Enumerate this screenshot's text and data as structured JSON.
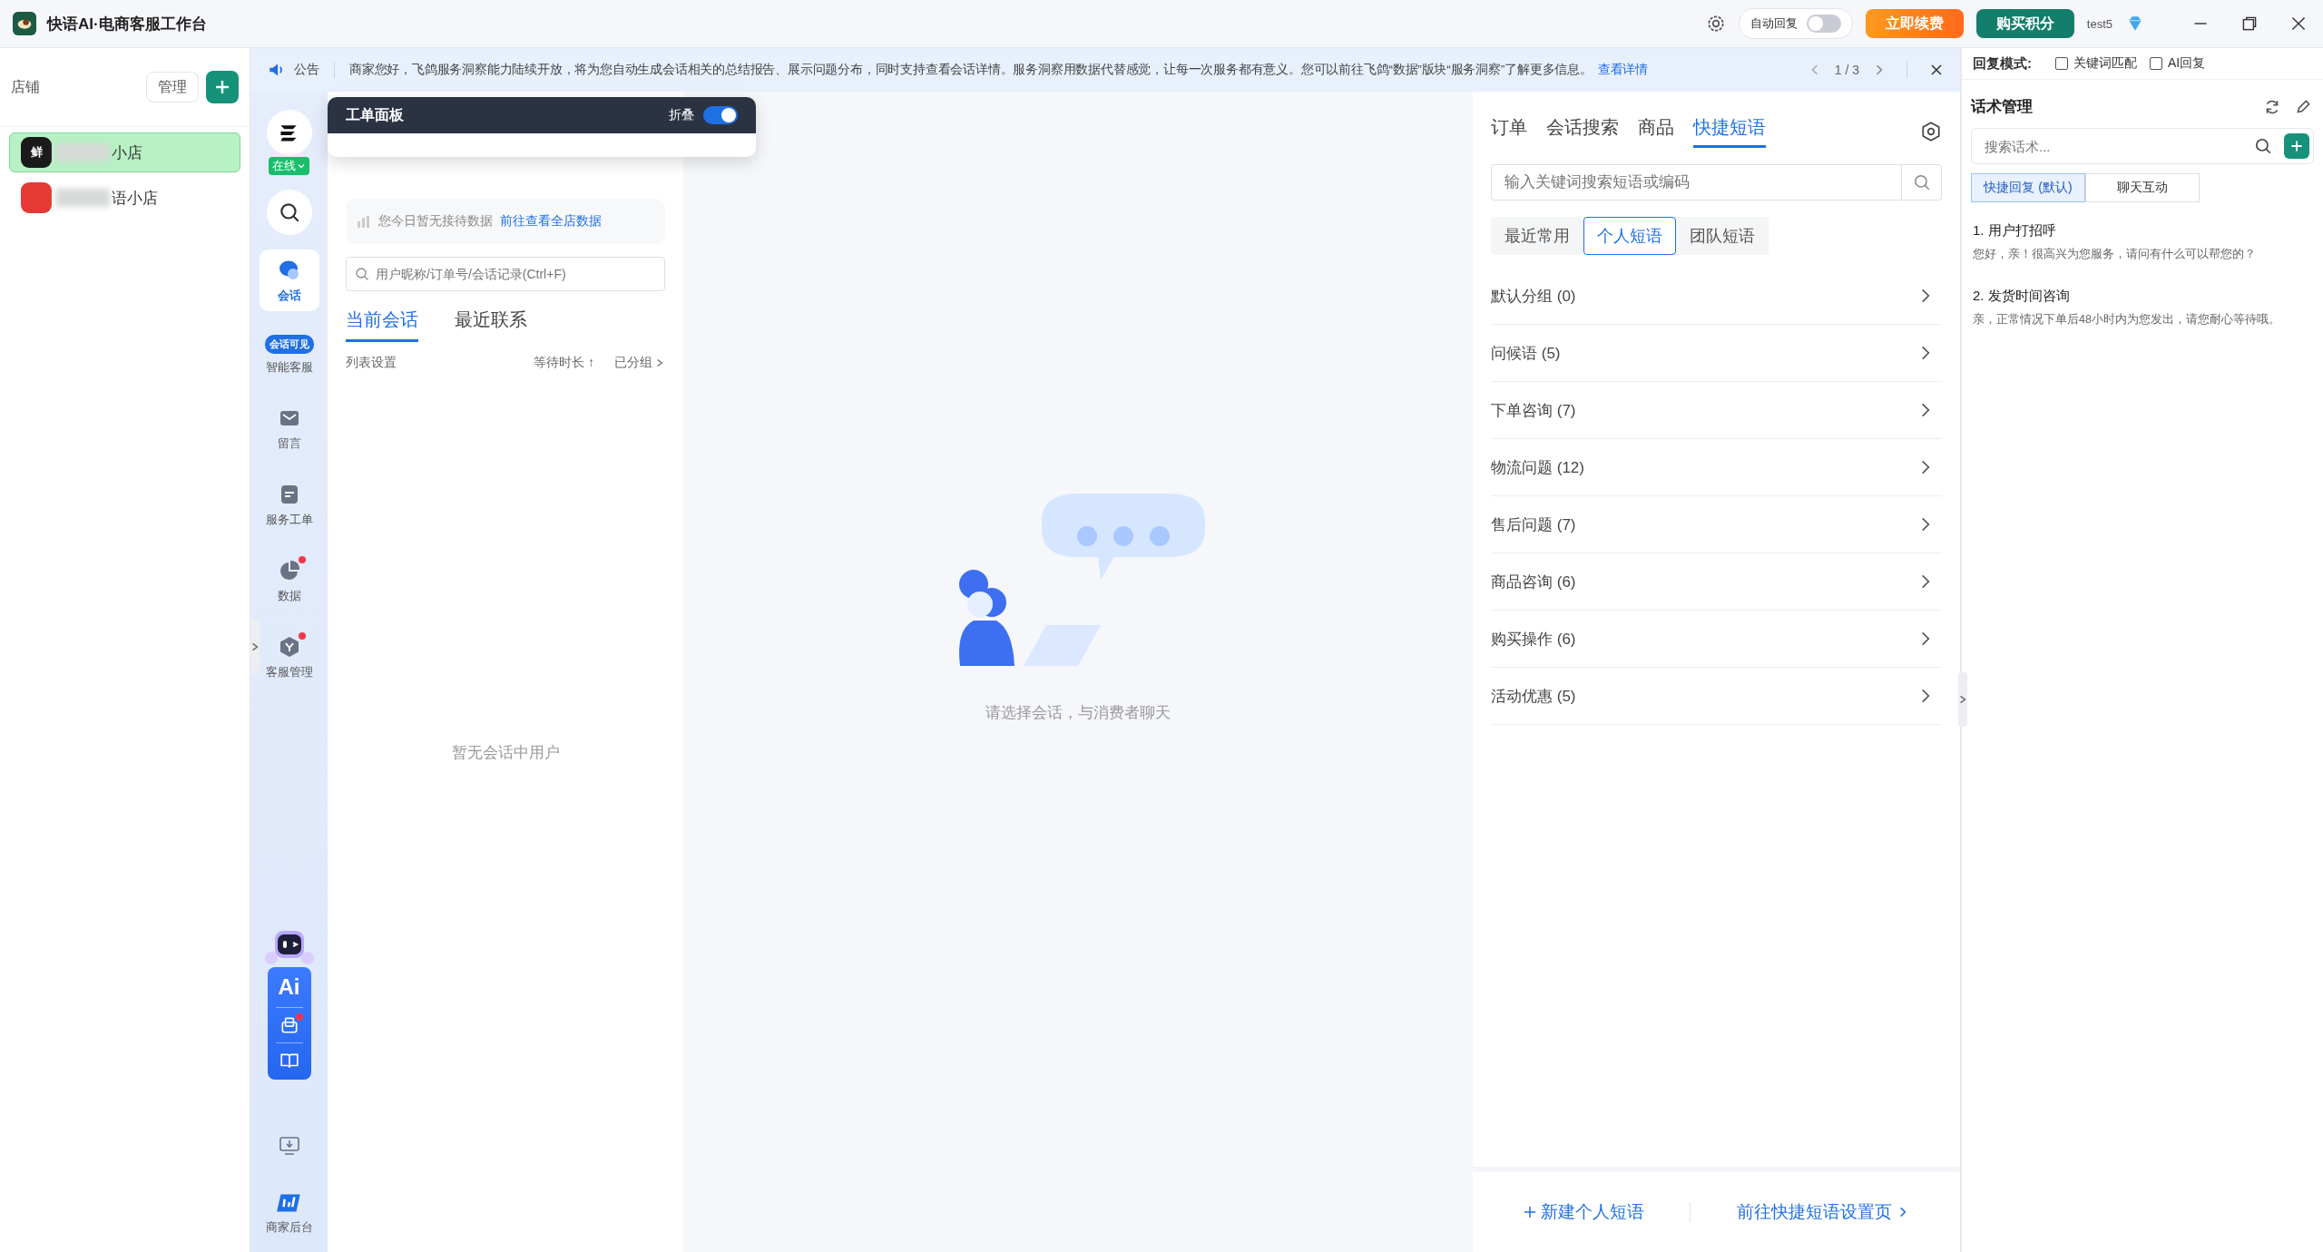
{
  "window": {
    "title": "快语AI·电商客服工作台",
    "auto_reply": {
      "label": "自动回复",
      "on": false
    },
    "buttons": [
      {
        "label": "立即续费",
        "kind": "renew"
      },
      {
        "label": "购买积分",
        "kind": "buy"
      }
    ],
    "user": "test5"
  },
  "shops": {
    "title": "店铺",
    "manage": "管理",
    "items": [
      {
        "avatar": "鲜",
        "name": "小店",
        "selected": true,
        "color": "#1a1a1a"
      },
      {
        "name": "语小店",
        "selected": false,
        "color": "#e53935"
      }
    ]
  },
  "notice": {
    "label": "公告",
    "text": "商家您好，飞鸽服务洞察能力陆续开放，将为您自动生成会话相关的总结报告、展示问题分布，同时支持查看会话详情。服务洞察用数据代替感觉，让每一次服务都有意义。您可以前往飞鸽“数据”版块“服务洞察”了解更多信息。",
    "link": "查看详情",
    "pager": "1 / 3"
  },
  "nav": {
    "status": "在线",
    "items": [
      {
        "label": "会话",
        "kind": "chat",
        "selected": true,
        "dot": false
      },
      {
        "label": "智能客服",
        "kind": "bot",
        "badge": "会话可见",
        "selected": false,
        "dot": false
      },
      {
        "label": "留言",
        "kind": "mail",
        "selected": false,
        "dot": false
      },
      {
        "label": "服务工单",
        "kind": "ticket",
        "selected": false,
        "dot": false
      },
      {
        "label": "数据",
        "kind": "pie",
        "selected": false,
        "dot": true
      },
      {
        "label": "客服管理",
        "kind": "manage",
        "selected": false,
        "dot": true
      }
    ],
    "ai_label": "Ai",
    "backend": "商家后台"
  },
  "work_panel": {
    "title": "工单面板",
    "toggle_label": "折叠",
    "on": true
  },
  "conversations": {
    "stats": "您今日暂无接待数据",
    "stats_link": "前往查看全店数据",
    "search_placeholder": "用户昵称/订单号/会话记录(Ctrl+F)",
    "tabs": [
      {
        "label": "当前会话",
        "selected": true
      },
      {
        "label": "最近联系",
        "selected": false
      }
    ],
    "list_settings": "列表设置",
    "sort": "等待时长 ↑",
    "group": "已分组",
    "empty": "暂无会话中用户"
  },
  "chat": {
    "empty": "请选择会话，与消费者聊天"
  },
  "tools": {
    "tabs": [
      {
        "label": "订单",
        "selected": false
      },
      {
        "label": "会话搜索",
        "selected": false
      },
      {
        "label": "商品",
        "selected": false
      },
      {
        "label": "快捷短语",
        "selected": true
      }
    ],
    "search_placeholder": "输入关键词搜索短语或编码",
    "subtabs": [
      {
        "label": "最近常用",
        "selected": false
      },
      {
        "label": "个人短语",
        "selected": true
      },
      {
        "label": "团队短语",
        "selected": false
      }
    ],
    "groups": [
      "默认分组 (0)",
      "问候语 (5)",
      "下单咨询 (7)",
      "物流问题 (12)",
      "售后问题 (7)",
      "商品咨询 (6)",
      "购买操作 (6)",
      "活动优惠 (5)"
    ],
    "new_phrase": "新建个人短语",
    "settings_link": "前往快捷短语设置页"
  },
  "scripts": {
    "mode_label": "回复模式:",
    "modes": [
      {
        "label": "关键词匹配",
        "checked": false
      },
      {
        "label": "AI回复",
        "checked": false
      }
    ],
    "title": "话术管理",
    "search_placeholder": "搜索话术...",
    "tabs": [
      {
        "label": "快捷回复 (默认)",
        "selected": true
      },
      {
        "label": "聊天互动",
        "selected": false
      }
    ],
    "items": [
      {
        "title": "1. 用户打招呼",
        "text": "您好，亲！很高兴为您服务，请问有什么可以帮您的？"
      },
      {
        "title": "2. 发货时间咨询",
        "text": "亲，正常情况下单后48小时内为您发出，请您耐心等待哦。"
      }
    ]
  }
}
